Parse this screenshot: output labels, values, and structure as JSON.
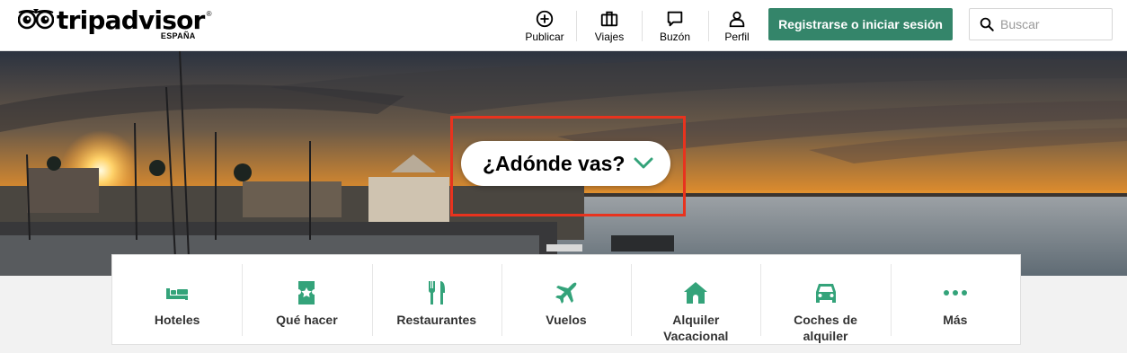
{
  "header": {
    "logo_text": "tripadvisor",
    "logo_registered": "®",
    "logo_subtitle": "ESPAÑA",
    "nav": [
      {
        "label": "Publicar",
        "icon": "plus-circle-icon"
      },
      {
        "label": "Viajes",
        "icon": "suitcase-icon"
      },
      {
        "label": "Buzón",
        "icon": "message-icon"
      },
      {
        "label": "Perfil",
        "icon": "user-icon"
      }
    ],
    "signin_label": "Registrarse o iniciar sesión",
    "search_placeholder": "Buscar"
  },
  "hero": {
    "where_label": "¿Adónde vas?"
  },
  "categories": [
    {
      "label": "Hoteles",
      "icon": "bed-icon"
    },
    {
      "label": "Qué hacer",
      "icon": "ticket-icon"
    },
    {
      "label": "Restaurantes",
      "icon": "fork-knife-icon"
    },
    {
      "label": "Vuelos",
      "icon": "plane-icon"
    },
    {
      "label": "Alquiler Vacacional",
      "icon": "house-icon"
    },
    {
      "label": "Coches de alquiler",
      "icon": "car-icon"
    },
    {
      "label": "Más",
      "icon": "more-dots-icon"
    }
  ],
  "colors": {
    "brand_green": "#34856a",
    "icon_green": "#34a37a",
    "highlight_red": "#e8331e"
  }
}
